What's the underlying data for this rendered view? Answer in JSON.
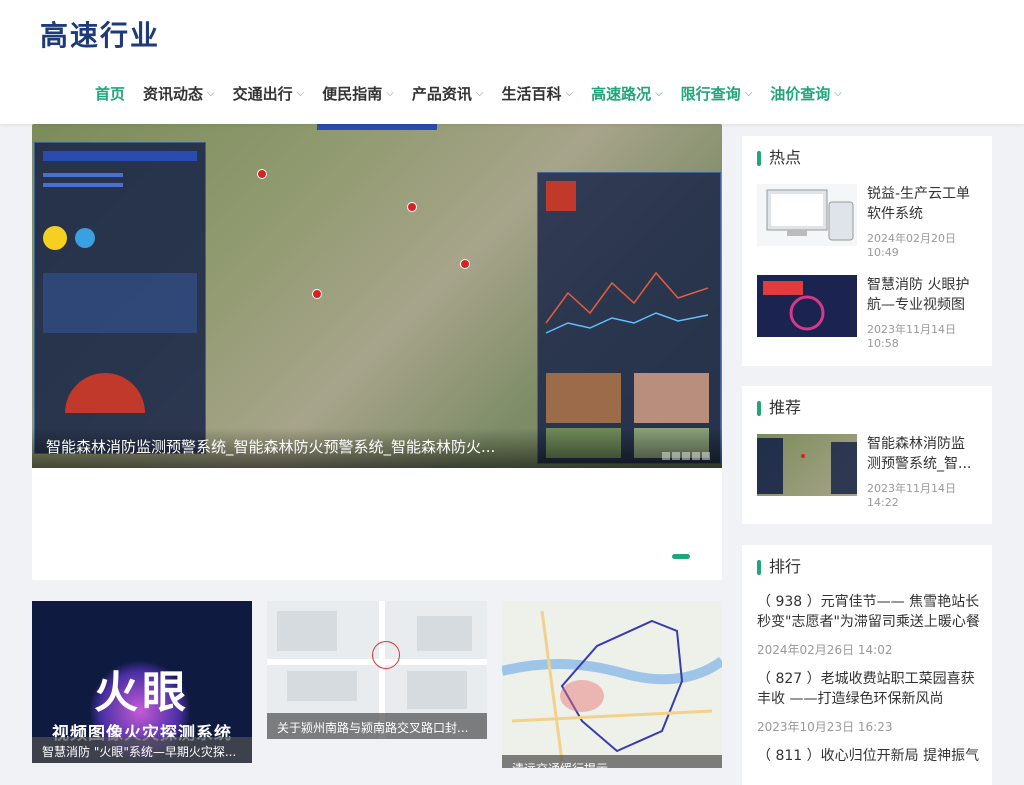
{
  "site": {
    "logo": "高速行业"
  },
  "nav": {
    "items": [
      {
        "label": "首页",
        "has_dropdown": false,
        "highlight": true
      },
      {
        "label": "资讯动态",
        "has_dropdown": true,
        "highlight": false
      },
      {
        "label": "交通出行",
        "has_dropdown": true,
        "highlight": false
      },
      {
        "label": "便民指南",
        "has_dropdown": true,
        "highlight": false
      },
      {
        "label": "产品资讯",
        "has_dropdown": true,
        "highlight": false
      },
      {
        "label": "生活百科",
        "has_dropdown": true,
        "highlight": false
      },
      {
        "label": "高速路况",
        "has_dropdown": true,
        "highlight": true
      },
      {
        "label": "限行查询",
        "has_dropdown": true,
        "highlight": true
      },
      {
        "label": "油价查询",
        "has_dropdown": true,
        "highlight": true
      }
    ]
  },
  "slider": {
    "caption": "智能森林消防监测预警系统_智能森林防火预警系统_智能森林防火...",
    "active_index": 0
  },
  "cards": [
    {
      "image_title": "火眼",
      "image_subtitle": "视频图像火灾探测系统",
      "caption": "智慧消防 \"火眼\"系统—早期火灾探..."
    },
    {
      "caption": "关于颍州南路与颍南路交叉路口封..."
    },
    {
      "caption": "清远交通缓行提示..."
    }
  ],
  "sidebar": {
    "hot": {
      "title": "热点",
      "items": [
        {
          "title": "锐益-生产云工单软件系统",
          "date": "2024年02月20日 10:49"
        },
        {
          "title": "智慧消防 火眼护航—专业视频图",
          "date": "2023年11月14日 10:58"
        }
      ]
    },
    "recommend": {
      "title": "推荐",
      "items": [
        {
          "title": "智能森林消防监测预警系统_智...",
          "date": "2023年11月14日 14:22"
        }
      ]
    },
    "rank": {
      "title": "排行",
      "items": [
        {
          "title": "（ 938 ）元宵佳节—— 焦雪艳站长秒变\"志愿者\"为滞留司乘送上暖心餐",
          "date": "2024年02月26日 14:02"
        },
        {
          "title": "（ 827 ）老城收费站职工菜园喜获丰收 ——打造绿色环保新风尚",
          "date": "2023年10月23日 16:23"
        },
        {
          "title": "（ 811 ）收心归位开新局 提神振气",
          "date": ""
        }
      ]
    }
  },
  "colors": {
    "accent": "#1fa67a",
    "logo": "#1e3a78",
    "background": "#f0f2f5"
  }
}
